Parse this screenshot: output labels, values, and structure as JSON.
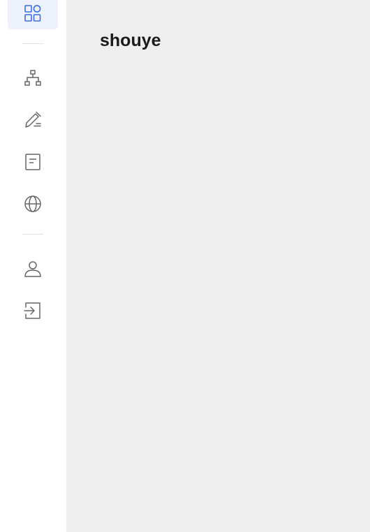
{
  "sidebar": {
    "items": [
      {
        "id": "home",
        "icon": "grid-apps-icon",
        "active": true
      },
      {
        "id": "structure",
        "icon": "hierarchy-icon",
        "active": false
      },
      {
        "id": "edit",
        "icon": "pen-edit-icon",
        "active": false
      },
      {
        "id": "document",
        "icon": "document-icon",
        "active": false
      },
      {
        "id": "web",
        "icon": "globe-icon",
        "active": false
      },
      {
        "id": "profile",
        "icon": "user-icon",
        "active": false
      },
      {
        "id": "logout",
        "icon": "logout-icon",
        "active": false
      }
    ]
  },
  "colors": {
    "accent": "#3b6fe3",
    "icon": "#666666",
    "active_bg": "#eef2fd",
    "main_bg": "#eeeeee"
  },
  "main": {
    "title": "shouye"
  }
}
